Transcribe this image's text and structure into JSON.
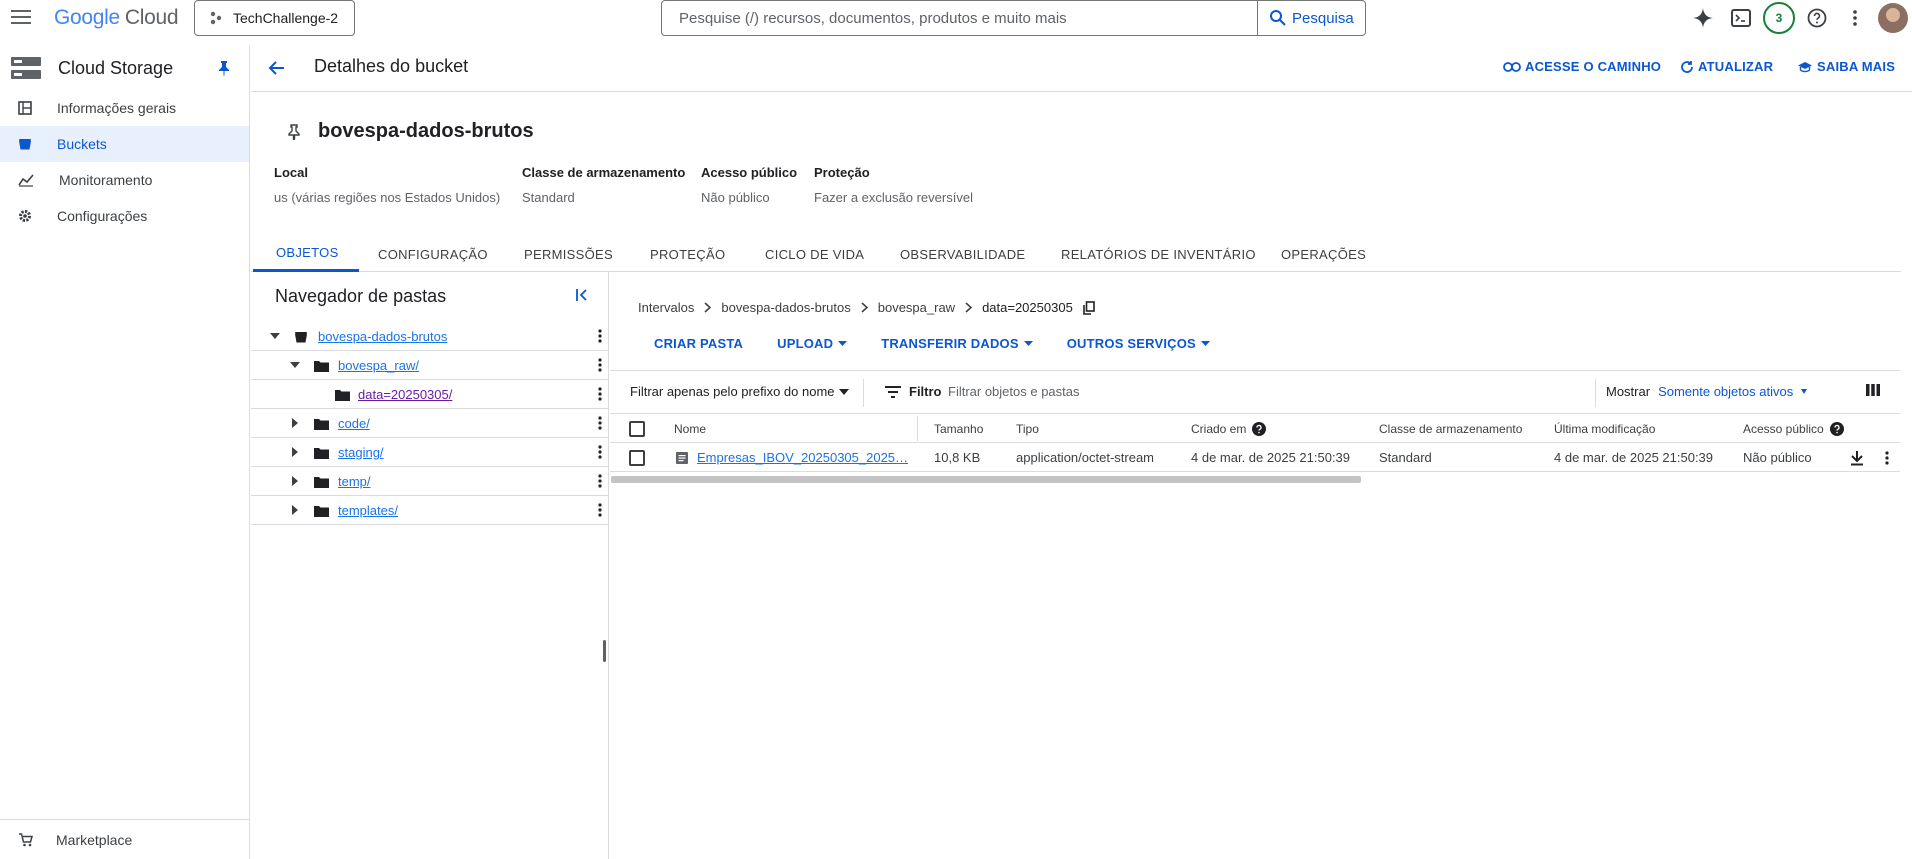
{
  "topbar": {
    "logo_google": "Google",
    "logo_cloud": "Cloud",
    "project": "TechChallenge-2",
    "search_placeholder": "Pesquise (/) recursos, documentos, produtos e muito mais",
    "search_button": "Pesquisa",
    "notifications_count": "3"
  },
  "sidebar": {
    "title": "Cloud Storage",
    "items": [
      {
        "label": "Informações gerais",
        "icon": "dashboard-icon"
      },
      {
        "label": "Buckets",
        "icon": "bucket-icon"
      },
      {
        "label": "Monitoramento",
        "icon": "chart-icon"
      },
      {
        "label": "Configurações",
        "icon": "gear-icon"
      }
    ],
    "marketplace": "Marketplace"
  },
  "header": {
    "title": "Detalhes do bucket",
    "actions": {
      "path": "ACESSE O CAMINHO",
      "refresh": "ATUALIZAR",
      "learn": "SAIBA MAIS"
    }
  },
  "bucket": {
    "name": "bovespa-dados-brutos",
    "info": [
      {
        "key": "Local",
        "value": "us (várias regiões nos Estados Unidos)"
      },
      {
        "key": "Classe de armazenamento",
        "value": "Standard"
      },
      {
        "key": "Acesso público",
        "value": "Não público"
      },
      {
        "key": "Proteção",
        "value": "Fazer a exclusão reversível"
      }
    ]
  },
  "tabs": [
    "OBJETOS",
    "CONFIGURAÇÃO",
    "PERMISSÕES",
    "PROTEÇÃO",
    "CICLO DE VIDA",
    "OBSERVABILIDADE",
    "RELATÓRIOS DE INVENTÁRIO",
    "OPERAÇÕES"
  ],
  "folder_panel": {
    "title": "Navegador de pastas",
    "tree": [
      {
        "label": "bovespa-dados-brutos"
      },
      {
        "label": "bovespa_raw/"
      },
      {
        "label": "data=20250305/"
      },
      {
        "label": "code/"
      },
      {
        "label": "staging/"
      },
      {
        "label": "temp/"
      },
      {
        "label": "templates/"
      }
    ]
  },
  "breadcrumb": [
    "Intervalos",
    "bovespa-dados-brutos",
    "bovespa_raw",
    "data=20250305"
  ],
  "object_actions": [
    "CRIAR PASTA",
    "UPLOAD",
    "TRANSFERIR DADOS",
    "OUTROS SERVIÇOS"
  ],
  "filterbar": {
    "prefix": "Filtrar apenas pelo prefixo do nome",
    "filter_label": "Filtro",
    "filter_placeholder": "Filtrar objetos e pastas",
    "show_label": "Mostrar",
    "show_value": "Somente objetos ativos"
  },
  "table": {
    "columns": [
      "Nome",
      "Tamanho",
      "Tipo",
      "Criado em",
      "Classe de armazenamento",
      "Última modificação",
      "Acesso público"
    ],
    "rows": [
      {
        "name": "Empresas_IBOV_20250305_2025…",
        "size": "10,8 KB",
        "type": "application/octet-stream",
        "created": "4 de mar. de 2025 21:50:39",
        "storage_class": "Standard",
        "modified": "4 de mar. de 2025 21:50:39",
        "public": "Não público"
      }
    ]
  },
  "colors": {
    "accent": "#0b57d0",
    "link": "#1a73e8",
    "visited": "#681da8",
    "active_bg": "#e8f0fe",
    "badge": "#188038"
  }
}
